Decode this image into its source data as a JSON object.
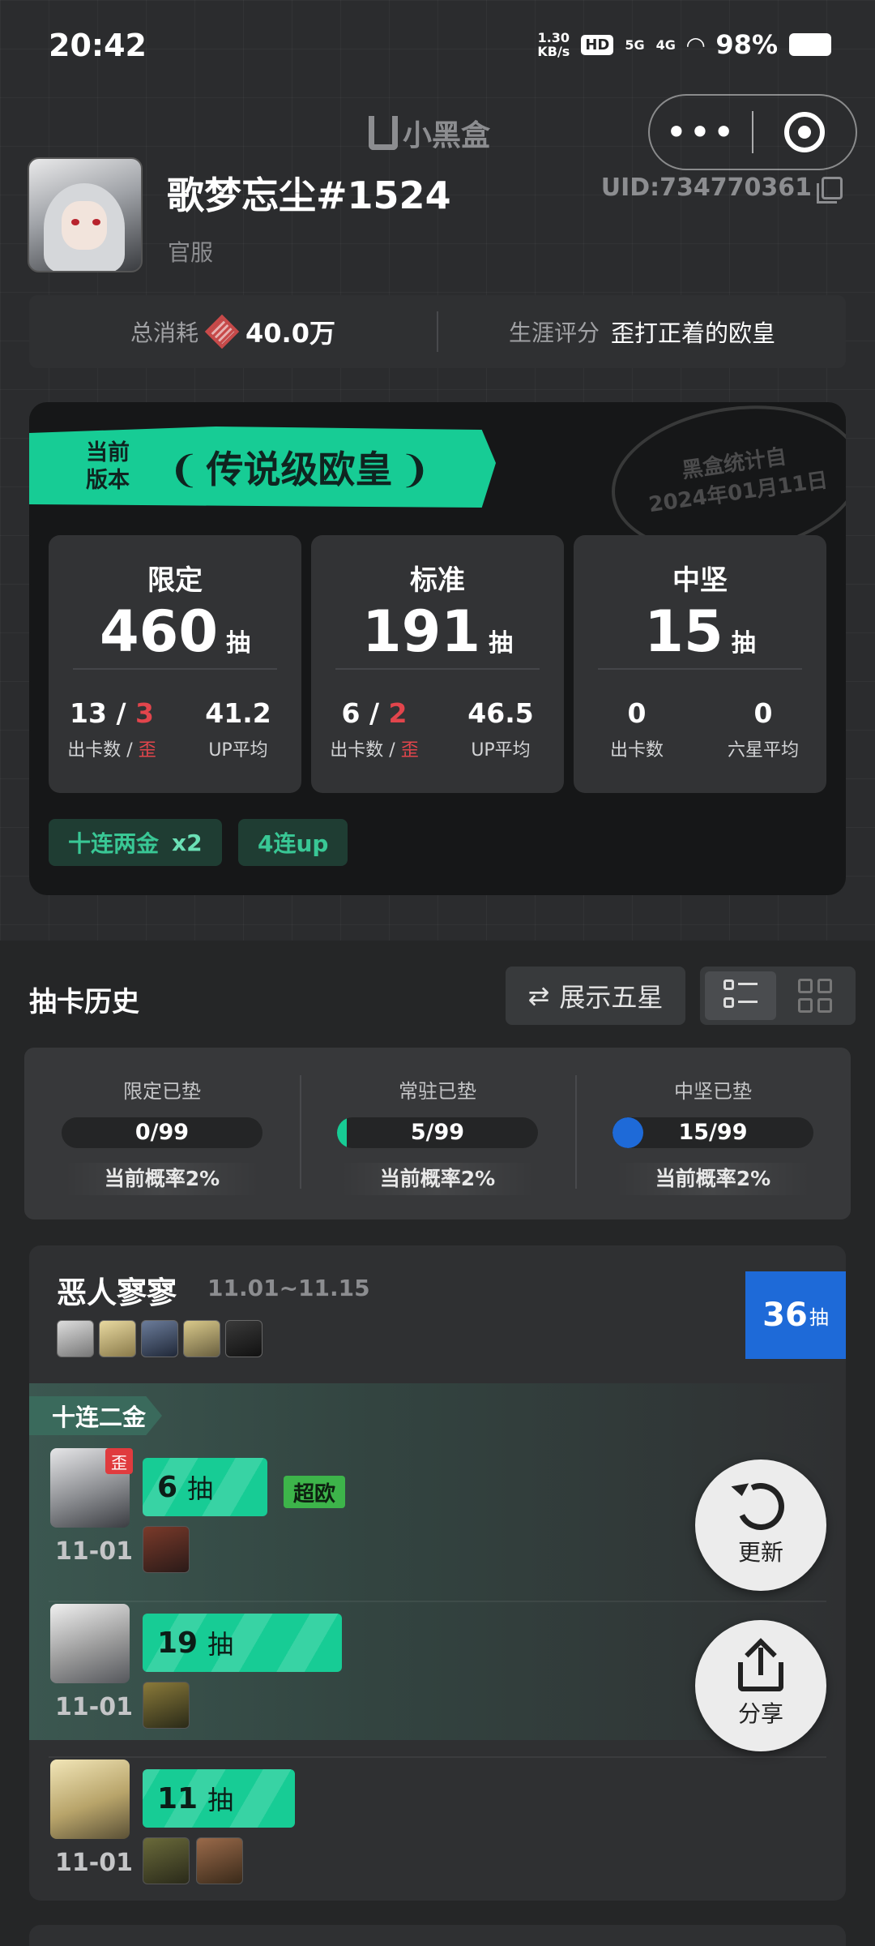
{
  "status_bar": {
    "time": "20:42",
    "net_speed": "1.30",
    "net_unit": "KB/s",
    "hd": "HD",
    "sig1": "5G",
    "sig2": "4G",
    "battery": "98%"
  },
  "app": {
    "brand": "小黑盒"
  },
  "profile": {
    "name": "歌梦忘尘#1524",
    "server": "官服",
    "uid": "UID:734770361"
  },
  "summary": {
    "total_label": "总消耗",
    "total_value": "40.0万",
    "rating_label": "生涯评分",
    "rating_value": "歪打正着的欧皇"
  },
  "card": {
    "banner_small_1": "当前",
    "banner_small_2": "版本",
    "banner_title": "传说级欧皇",
    "stamp_line1": "黑盒统计自",
    "stamp_line2": "2024年01月11日",
    "stats": [
      {
        "title": "限定",
        "count": "460",
        "unit": "抽",
        "a_main": "13 / ",
        "a_red": "3",
        "a_label": "出卡数 / ",
        "a_label_red": "歪",
        "b_val": "41.2",
        "b_label": "UP平均"
      },
      {
        "title": "标准",
        "count": "191",
        "unit": "抽",
        "a_main": "6 / ",
        "a_red": "2",
        "a_label": "出卡数 / ",
        "a_label_red": "歪",
        "b_val": "46.5",
        "b_label": "UP平均"
      },
      {
        "title": "中坚",
        "count": "15",
        "unit": "抽",
        "a_main": "0",
        "a_red": "",
        "a_label": "出卡数",
        "a_label_red": "",
        "b_val": "0",
        "b_label": "六星平均"
      }
    ],
    "tags": [
      {
        "text": "十连两金",
        "extra": "x2"
      },
      {
        "text": "4连up",
        "extra": ""
      }
    ]
  },
  "history": {
    "title": "抽卡历史",
    "show_label": "展示五星",
    "pity": [
      {
        "label": "限定已垫",
        "value": "0/99",
        "fill": 0.0,
        "rate": "当前概率2%"
      },
      {
        "label": "常驻已垫",
        "value": "5/99",
        "fill": 0.05,
        "rate": "当前概率2%"
      },
      {
        "label": "中坚已垫",
        "value": "15/99",
        "fill": 0.15,
        "rate": "当前概率2%"
      }
    ]
  },
  "pool": {
    "name": "恶人寥寥",
    "dates": "11.01~11.15",
    "total_num": "36",
    "total_unit": "抽",
    "group_tag": "十连二金",
    "rows": [
      {
        "date": "11-01",
        "pulls": "6",
        "unit": "抽",
        "badge": "超欧",
        "oops": "歪"
      },
      {
        "date": "11-01",
        "pulls": "19",
        "unit": "抽",
        "badge": "",
        "oops": ""
      },
      {
        "date": "11-01",
        "pulls": "11",
        "unit": "抽",
        "badge": "",
        "oops": ""
      }
    ]
  },
  "fab": {
    "refresh": "更新",
    "share": "分享"
  },
  "colors": {
    "accent": "#17cc95",
    "warn": "#e2454c",
    "blue": "#1e6ad8"
  }
}
